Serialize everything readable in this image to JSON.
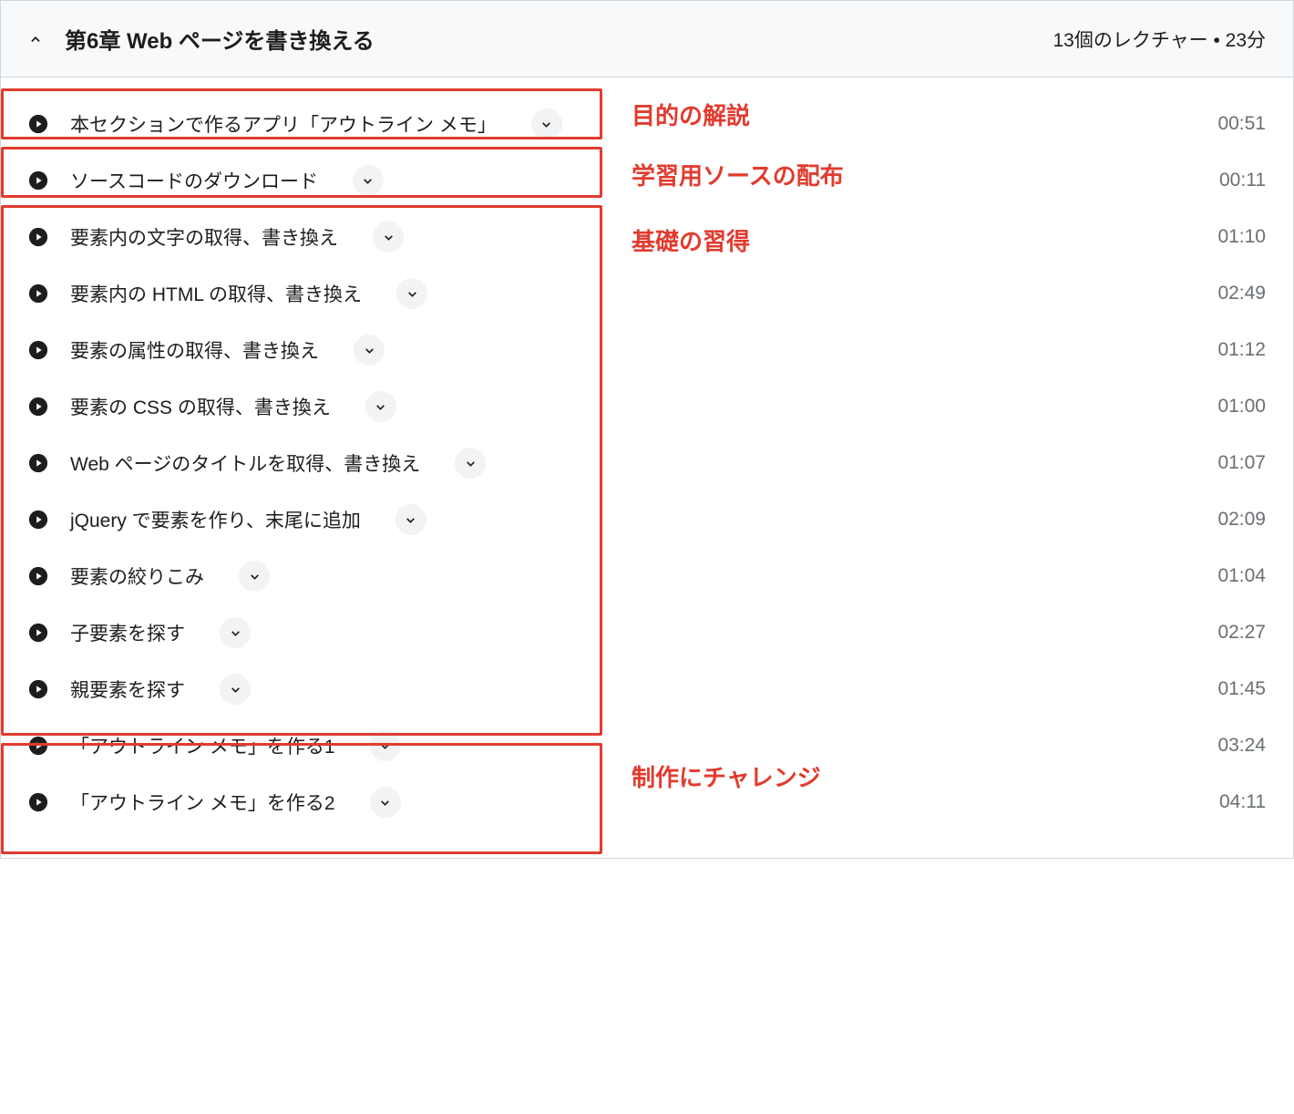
{
  "section": {
    "title": "第6章 Web ページを書き換える",
    "meta": "13個のレクチャー • 23分"
  },
  "lectures": [
    {
      "title": "本セクションで作るアプリ「アウトライン メモ」",
      "duration": "00:51"
    },
    {
      "title": "ソースコードのダウンロード",
      "duration": "00:11"
    },
    {
      "title": "要素内の文字の取得、書き換え",
      "duration": "01:10"
    },
    {
      "title": "要素内の HTML の取得、書き換え",
      "duration": "02:49"
    },
    {
      "title": "要素の属性の取得、書き換え",
      "duration": "01:12"
    },
    {
      "title": "要素の CSS の取得、書き換え",
      "duration": "01:00"
    },
    {
      "title": "Web ページのタイトルを取得、書き換え",
      "duration": "01:07"
    },
    {
      "title": "jQuery で要素を作り、末尾に追加",
      "duration": "02:09"
    },
    {
      "title": "要素の絞りこみ",
      "duration": "01:04"
    },
    {
      "title": "子要素を探す",
      "duration": "02:27"
    },
    {
      "title": "親要素を探す",
      "duration": "01:45"
    },
    {
      "title": "「アウトライン メモ」を作る1",
      "duration": "03:24"
    },
    {
      "title": "「アウトライン メモ」を作る2",
      "duration": "04:11"
    }
  ],
  "annotations": {
    "a1": "目的の解説",
    "a2": "学習用ソースの配布",
    "a3": "基礎の習得",
    "a4": "制作にチャレンジ"
  },
  "colors": {
    "highlight": "#e23b2e",
    "muted": "#6a6f73"
  }
}
